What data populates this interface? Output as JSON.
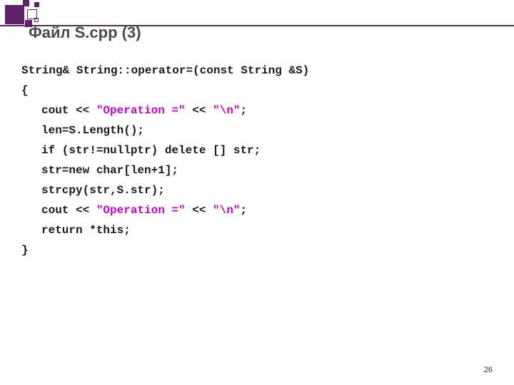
{
  "title": "Файл S.cpp (3)",
  "code": {
    "l1": "String& String::operator=(const String &S)",
    "l2": "{",
    "l3a": "cout << ",
    "l3b": "\"Operation =\"",
    "l3c": " << ",
    "l3d": "\"\\n\"",
    "l3e": ";",
    "l4": "len=S.Length();",
    "l5": "if (str!=nullptr) delete [] str;",
    "l6": "str=new char[len+1];",
    "l7": "strcpy(str,S.str);",
    "l8a": "cout << ",
    "l8b": "\"Operation =\"",
    "l8c": " << ",
    "l8d": "\"\\n\"",
    "l8e": ";",
    "l9": "return *this;",
    "l10": "}"
  },
  "pageNumber": "26"
}
